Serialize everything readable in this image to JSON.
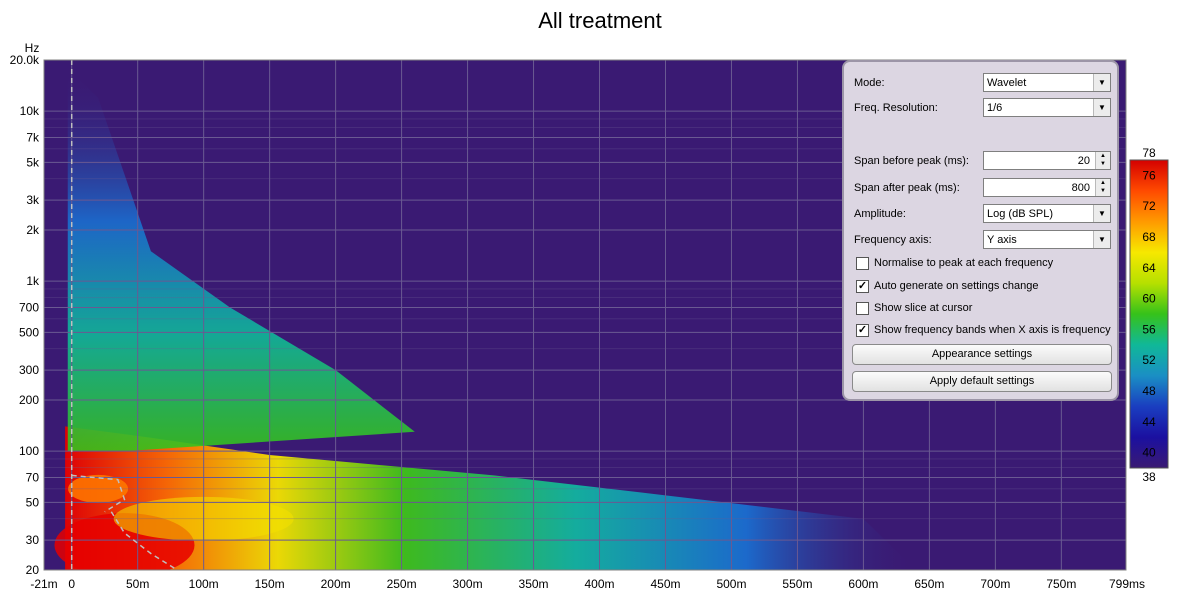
{
  "chart": {
    "title": "All treatment",
    "y_unit": "Hz",
    "y_ticks": [
      "20.0k",
      "10k",
      "7k",
      "5k",
      "3k",
      "2k",
      "1k",
      "700",
      "500",
      "300",
      "200",
      "100",
      "70",
      "50",
      "30",
      "20"
    ],
    "x_ticks": [
      "-21m",
      "0",
      "50m",
      "100m",
      "150m",
      "200m",
      "250m",
      "300m",
      "350m",
      "400m",
      "450m",
      "500m",
      "550m",
      "600m",
      "650m",
      "700m",
      "750m",
      "799ms"
    ],
    "colorbar_ticks": [
      "78",
      "76",
      "72",
      "68",
      "64",
      "60",
      "56",
      "52",
      "48",
      "44",
      "40",
      "38"
    ]
  },
  "chart_data": {
    "type": "heatmap",
    "title": "All treatment",
    "xlabel": "ms",
    "ylabel": "Hz",
    "x_range": [
      -21,
      799
    ],
    "y_range": [
      20,
      20000
    ],
    "y_scale": "log",
    "z_range": [
      38,
      78
    ],
    "z_unit": "dB SPL",
    "grid": true,
    "colorbar_position": "right"
  },
  "panel": {
    "mode_label": "Mode:",
    "mode_value": "Wavelet",
    "freq_res_label": "Freq. Resolution:",
    "freq_res_value": "1/6",
    "span_before_label": "Span before peak (ms):",
    "span_before_value": "20",
    "span_after_label": "Span after peak (ms):",
    "span_after_value": "800",
    "amplitude_label": "Amplitude:",
    "amplitude_value": "Log (dB SPL)",
    "freq_axis_label": "Frequency axis:",
    "freq_axis_value": "Y axis",
    "cb_normalise": "Normalise to peak at each frequency",
    "cb_auto": "Auto generate on settings change",
    "cb_slice": "Show slice at cursor",
    "cb_bands": "Show frequency bands when X axis is frequency",
    "checked_mark": "✓",
    "btn_appearance": "Appearance settings",
    "btn_default": "Apply default settings"
  },
  "colors": {
    "background": "#3a1a73",
    "grid": "#6a5a92",
    "panel": "#dcd6e2"
  }
}
